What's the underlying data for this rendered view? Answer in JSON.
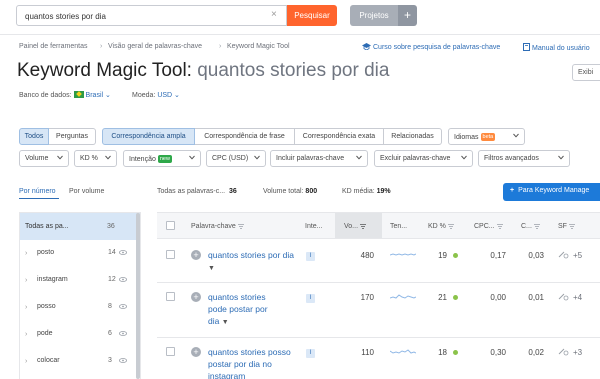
{
  "search": {
    "value": "quantos stories por dia",
    "clear": "×",
    "button": "Pesquisar"
  },
  "projects": {
    "label": "Projetos",
    "plus": "+"
  },
  "breadcrumb": [
    "Painel de ferramentas",
    "Visão geral de palavras-chave",
    "Keyword Magic Tool"
  ],
  "breadcrumb_sep": "›",
  "links": {
    "course": "Curso sobre pesquisa de palavras-chave",
    "manual": "Manual do usuário"
  },
  "title": {
    "tool": "Keyword Magic Tool:",
    "query": "quantos stories por dia"
  },
  "export_label": "Exibi",
  "database": {
    "label": "Banco de dados:",
    "value": "Brasil",
    "currency_label": "Moeda:",
    "currency": "USD"
  },
  "match_tabs": [
    {
      "label": "Todos",
      "selected": true
    },
    {
      "label": "Perguntas",
      "selected": false
    }
  ],
  "match_types": [
    {
      "label": "Correspondência ampla",
      "selected": true
    },
    {
      "label": "Correspondência de frase",
      "selected": false
    },
    {
      "label": "Correspondência exata",
      "selected": false
    },
    {
      "label": "Relacionadas",
      "selected": false
    }
  ],
  "languages": {
    "label": "Idiomas",
    "badge": "beta"
  },
  "filters": [
    "Volume",
    "KD %",
    "Intenção",
    "CPC (USD)",
    "Incluir palavras-chave",
    "Excluir palavras-chave",
    "Filtros avançados"
  ],
  "intent_badge": "new",
  "group_tabs": {
    "by_number": "Por número",
    "by_volume": "Por volume"
  },
  "stats": {
    "all_label": "Todas as palavras-c...",
    "all_value": "36",
    "volume_label": "Volume total:",
    "volume_value": "800",
    "kd_label": "KD média:",
    "kd_value": "19%"
  },
  "add_button": "Para Keyword Manage",
  "groups": {
    "all": {
      "label": "Todas as pa...",
      "count": "36"
    },
    "items": [
      {
        "label": "posto",
        "count": "14"
      },
      {
        "label": "instagram",
        "count": "12"
      },
      {
        "label": "posso",
        "count": "8"
      },
      {
        "label": "pode",
        "count": "6"
      },
      {
        "label": "colocar",
        "count": "3"
      }
    ]
  },
  "table": {
    "headers": {
      "keyword": "Palavra-chave",
      "intent": "Inte...",
      "volume": "Vo...",
      "trend": "Ten...",
      "kd": "KD %",
      "cpc": "CPC...",
      "com": "C...",
      "sf": "SF"
    },
    "intent_code": "I",
    "rows": [
      {
        "keyword": "quantos stories por dia",
        "volume": "480",
        "kd": "19",
        "cpc": "0,17",
        "com": "0,03",
        "sf": "+5"
      },
      {
        "keyword": "quantos stories pode postar por dia",
        "volume": "170",
        "kd": "21",
        "cpc": "0,00",
        "com": "0,01",
        "sf": "+4"
      },
      {
        "keyword": "quantos stories posso postar por dia no instagram",
        "volume": "110",
        "kd": "18",
        "cpc": "0,30",
        "com": "0,02",
        "sf": "+3"
      }
    ]
  },
  "colors": {
    "accent": "#ff642d",
    "link": "#2d6cb5",
    "primary": "#1d7ad9",
    "selected": "#d7e6f6",
    "kd_dot": "#8bc34a"
  }
}
